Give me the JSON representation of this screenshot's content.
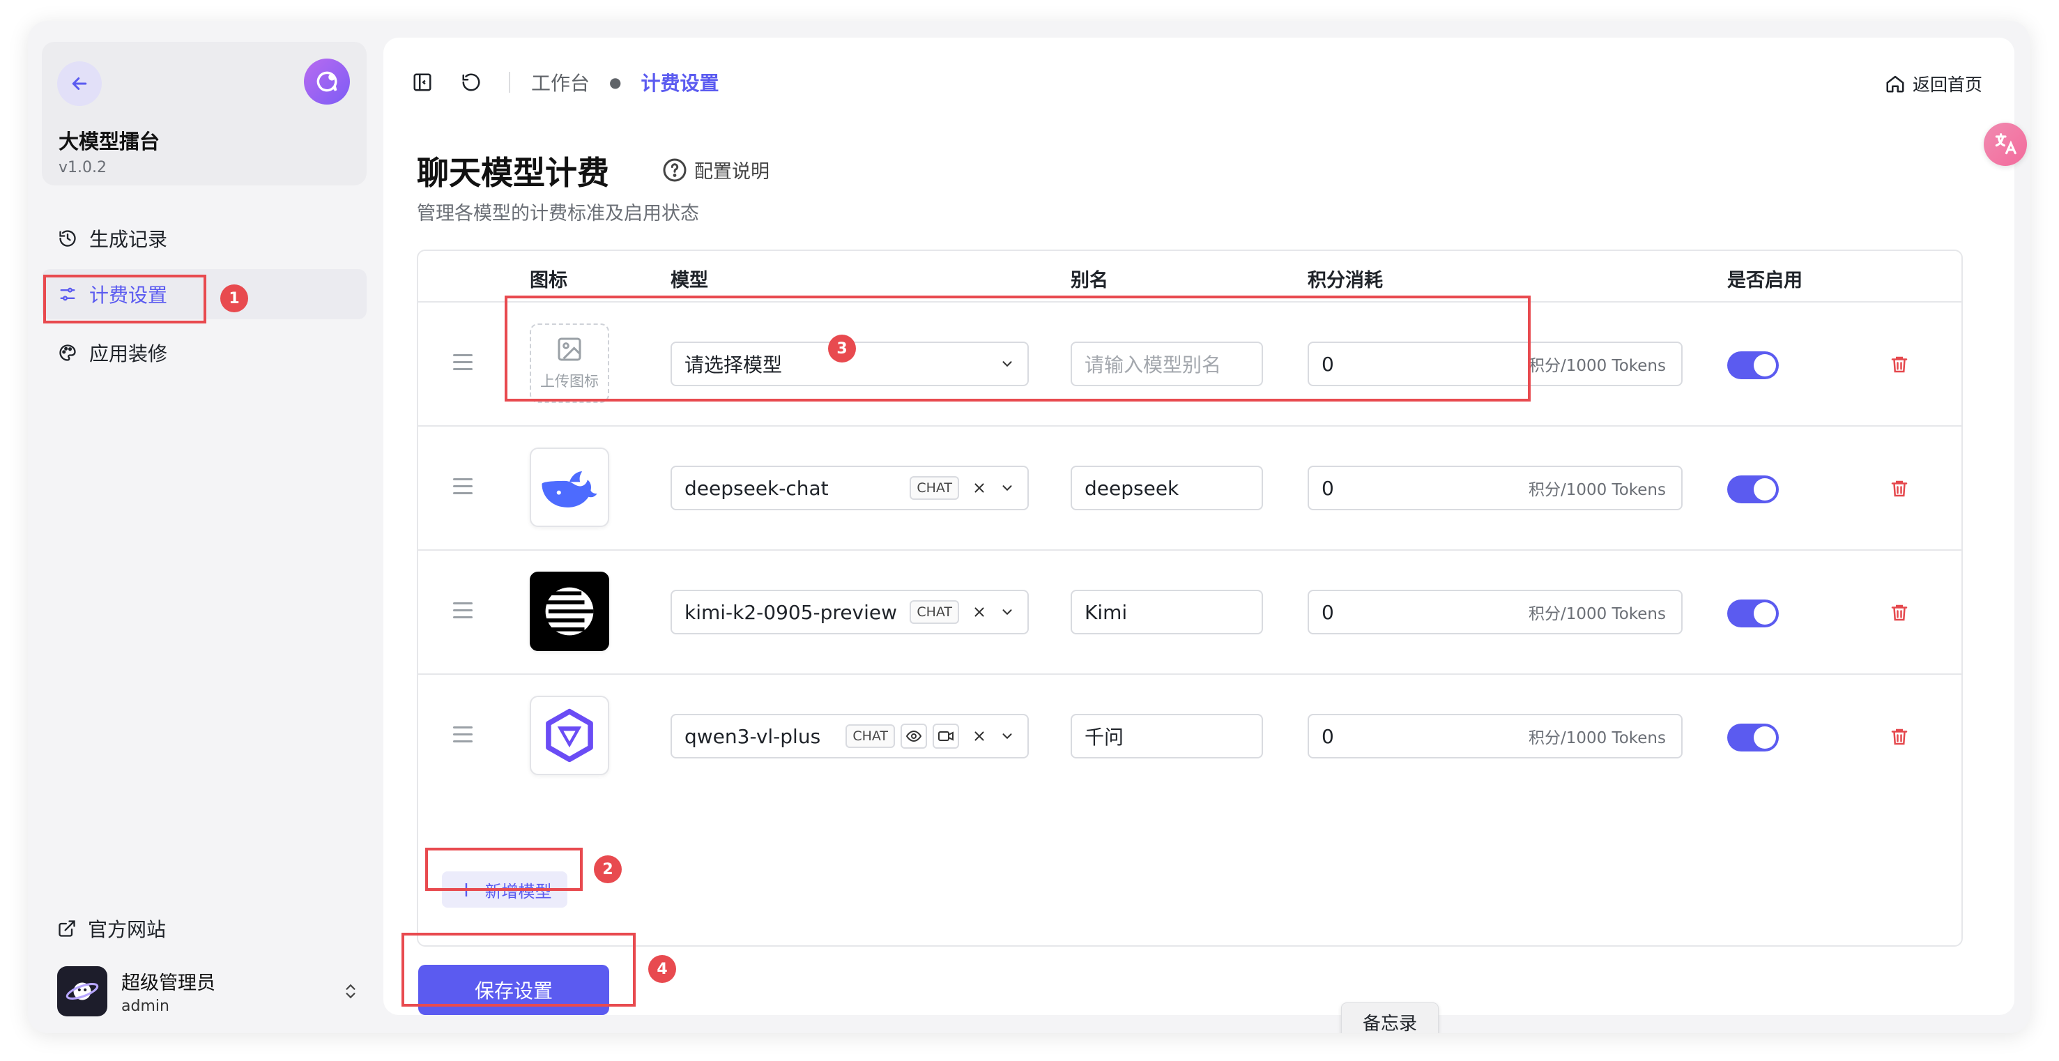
{
  "app": {
    "title": "大模型擂台",
    "version": "v1.0.2"
  },
  "sidebar": {
    "items": [
      {
        "label": "生成记录",
        "icon": "history-icon"
      },
      {
        "label": "计费设置",
        "icon": "sliders-icon",
        "active": true
      },
      {
        "label": "应用装修",
        "icon": "palette-icon"
      }
    ],
    "external_link": "官方网站",
    "user": {
      "name": "超级管理员",
      "role": "admin"
    }
  },
  "header": {
    "breadcrumb": [
      "工作台",
      "计费设置"
    ],
    "home_link": "返回首页"
  },
  "page": {
    "title": "聊天模型计费",
    "help": "配置说明",
    "subtitle": "管理各模型的计费标准及启用状态"
  },
  "table": {
    "columns": [
      "图标",
      "模型",
      "别名",
      "积分消耗",
      "是否启用"
    ],
    "upload_label": "上传图标",
    "rows": [
      {
        "model": "",
        "model_placeholder": "请选择模型",
        "tags": [],
        "alias": "",
        "alias_placeholder": "请输入模型别名",
        "score": "0",
        "unit": "积分/1000 Tokens",
        "enabled": true
      },
      {
        "model": "deepseek-chat",
        "tags": [
          "CHAT"
        ],
        "alias": "deepseek",
        "score": "0",
        "unit": "积分/1000 Tokens",
        "enabled": true
      },
      {
        "model": "kimi-k2-0905-preview",
        "tags": [
          "CHAT"
        ],
        "alias": "Kimi",
        "score": "0",
        "unit": "积分/1000 Tokens",
        "enabled": true
      },
      {
        "model": "qwen3-vl-plus",
        "tags": [
          "CHAT"
        ],
        "alias": "千问",
        "score": "0",
        "unit": "积分/1000 Tokens",
        "enabled": true
      }
    ],
    "add_label": "新增模型"
  },
  "save_label": "保存设置",
  "memo_label": "备忘录",
  "annotations": [
    "1",
    "2",
    "3",
    "4"
  ],
  "colors": {
    "accent": "#5b5bf0",
    "annotation": "#e84a4f",
    "danger": "#e5484d"
  }
}
